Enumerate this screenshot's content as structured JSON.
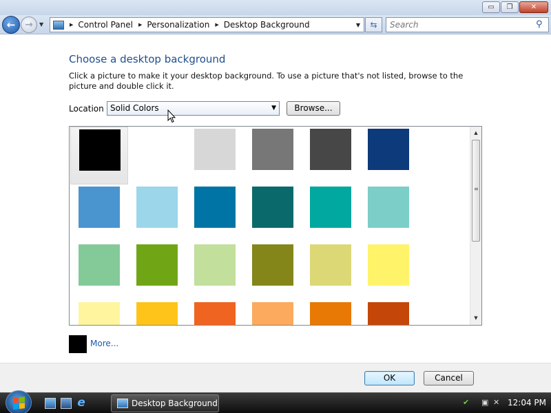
{
  "window": {
    "controls": {
      "minimize": "▭",
      "maximize": "❐",
      "close": "✕"
    }
  },
  "addressbar": {
    "breadcrumbs": [
      "Control Panel",
      "Personalization",
      "Desktop Background"
    ],
    "search_placeholder": "Search"
  },
  "content": {
    "heading": "Choose a desktop background",
    "description": "Click a picture to make it your desktop background. To use a picture that's not listed, browse to the picture and double click it.",
    "location_label": "Location",
    "location_value": "Solid Colors",
    "browse_label": "Browse...",
    "more_label": "More...",
    "more_color": "#000000"
  },
  "colors": [
    [
      "#000000",
      "#FFFFFF",
      "#D7D7D7",
      "#777777",
      "#474747",
      "#0C3A7A"
    ],
    [
      "#4A94D0",
      "#9CD6EA",
      "#0075A5",
      "#0A6A6B",
      "#00A8A0",
      "#7BCFC8"
    ],
    [
      "#84C998",
      "#70A616",
      "#C2DF9C",
      "#84861A",
      "#DDD876",
      "#FFF36A"
    ],
    [
      "#FFF59E",
      "#FFC41A",
      "#EF6420",
      "#FBAA5E",
      "#E87904",
      "#C44709"
    ]
  ],
  "selected_color_index": 0,
  "footer": {
    "ok_label": "OK",
    "cancel_label": "Cancel"
  },
  "taskbar": {
    "task_label": "Desktop Background",
    "clock": "12:04 PM"
  }
}
